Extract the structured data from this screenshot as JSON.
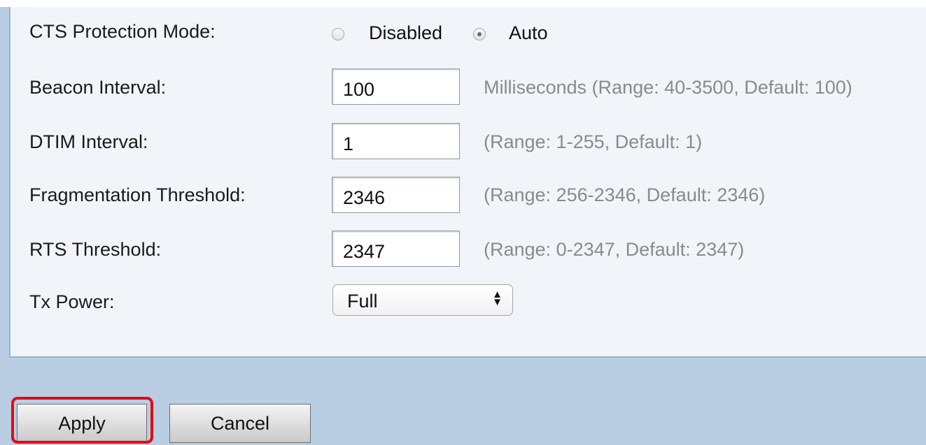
{
  "settings": {
    "cts_protection_mode": {
      "label": "CTS Protection Mode:",
      "options": [
        "Disabled",
        "Auto"
      ],
      "selected": "Auto"
    },
    "beacon_interval": {
      "label": "Beacon Interval:",
      "value": "100",
      "hint": "Milliseconds (Range: 40-3500, Default: 100)"
    },
    "dtim_interval": {
      "label": "DTIM Interval:",
      "value": "1",
      "hint": "(Range: 1-255, Default: 1)"
    },
    "fragmentation_threshold": {
      "label": "Fragmentation Threshold:",
      "value": "2346",
      "hint": "(Range: 256-2346, Default: 2346)"
    },
    "rts_threshold": {
      "label": "RTS Threshold:",
      "value": "2347",
      "hint": "(Range: 0-2347, Default: 2347)"
    },
    "tx_power": {
      "label": "Tx Power:",
      "value": "Full"
    }
  },
  "actions": {
    "apply_label": "Apply",
    "cancel_label": "Cancel"
  },
  "colors": {
    "panel_background": "#f1f5fa",
    "page_background": "#b9cde3",
    "highlight": "#e30b13",
    "hint_text": "#8a8a8a"
  }
}
